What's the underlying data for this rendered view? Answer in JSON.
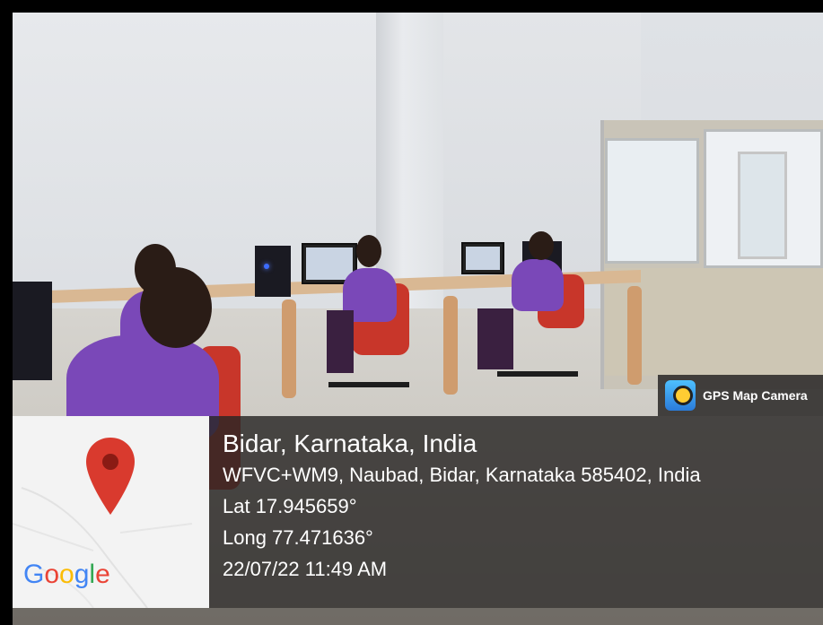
{
  "badge": {
    "icon": "gps-camera-icon",
    "label": "GPS Map Camera"
  },
  "map": {
    "pin_icon": "map-pin-icon",
    "pin_color": "#d93a2e",
    "brand": "Google"
  },
  "location": {
    "title": "Bidar, Karnataka, India",
    "address": "WFVC+WM9, Naubad, Bidar, Karnataka 585402, India",
    "latitude": "Lat 17.945659°",
    "longitude": "Long 77.471636°",
    "datetime": "22/07/22 11:49 AM"
  },
  "colors": {
    "overlay_bg": "#2a2624",
    "shirt": "#7a48b8",
    "chair": "#c8362a"
  }
}
